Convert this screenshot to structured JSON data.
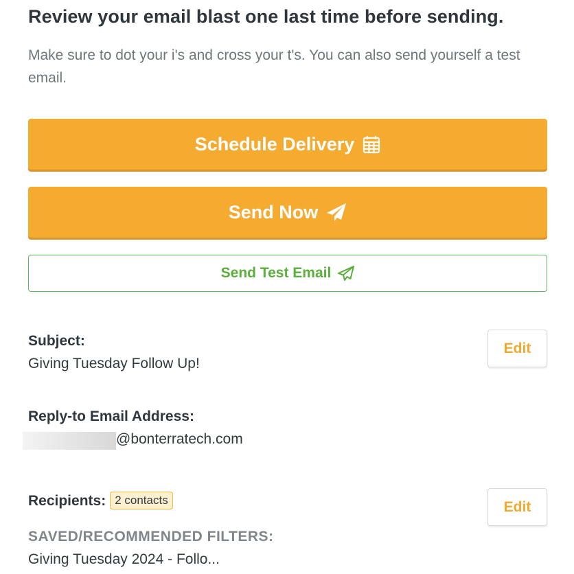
{
  "header": {
    "title": "Review your email blast one last time before sending.",
    "subtitle": "Make sure to dot your i's and cross your t's. You can also send yourself a test email."
  },
  "actions": {
    "schedule_label": "Schedule Delivery",
    "send_now_label": "Send Now",
    "send_test_label": "Send Test Email"
  },
  "subject": {
    "label": "Subject:",
    "value": "Giving Tuesday Follow Up!",
    "edit_label": "Edit"
  },
  "reply_to": {
    "label": "Reply-to Email Address:",
    "domain": "@bonterratech.com"
  },
  "recipients": {
    "label": "Recipients:",
    "count_badge": "2 contacts",
    "edit_label": "Edit",
    "filters_label": "SAVED/RECOMMENDED FILTERS:",
    "filter_value": "Giving Tuesday 2024 - Follo..."
  },
  "colors": {
    "primary": "#f5ab30",
    "success": "#5aae3c",
    "edit_text": "#f0a830",
    "badge_bg": "#fdf0cf"
  },
  "icons": {
    "schedule": "calendar-icon",
    "send_now": "paper-plane-solid-icon",
    "send_test": "paper-plane-outline-icon"
  }
}
